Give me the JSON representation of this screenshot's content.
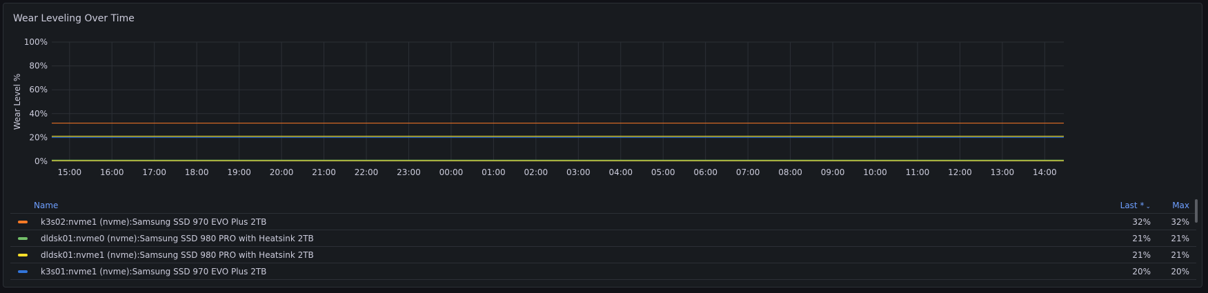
{
  "panel": {
    "title": "Wear Leveling Over Time"
  },
  "legend": {
    "name_header": "Name",
    "last_header": "Last *",
    "max_header": "Max",
    "rows": [
      {
        "name": "k3s02:nvme1 (nvme):Samsung SSD 970 EVO Plus 2TB",
        "color": "#ff7a26",
        "last": "32%",
        "max": "32%"
      },
      {
        "name": "dldsk01:nvme0 (nvme):Samsung SSD 980 PRO with Heatsink 2TB",
        "color": "#73bf69",
        "last": "21%",
        "max": "21%"
      },
      {
        "name": "dldsk01:nvme1 (nvme):Samsung SSD 980 PRO with Heatsink 2TB",
        "color": "#fade2a",
        "last": "21%",
        "max": "21%"
      },
      {
        "name": "k3s01:nvme1 (nvme):Samsung SSD 970 EVO Plus 2TB",
        "color": "#3274d9",
        "last": "20%",
        "max": "20%"
      }
    ]
  },
  "chart_data": {
    "type": "line",
    "title": "Wear Leveling Over Time",
    "xlabel": "",
    "ylabel": "Wear Level %",
    "ylim": [
      0,
      100
    ],
    "y_ticks": [
      "0%",
      "20%",
      "40%",
      "60%",
      "80%",
      "100%"
    ],
    "x_range_hours": [
      14.58,
      14.45
    ],
    "x_ticks": [
      "15:00",
      "16:00",
      "17:00",
      "18:00",
      "19:00",
      "20:00",
      "21:00",
      "22:00",
      "23:00",
      "00:00",
      "01:00",
      "02:00",
      "03:00",
      "04:00",
      "05:00",
      "06:00",
      "07:00",
      "08:00",
      "09:00",
      "10:00",
      "11:00",
      "12:00",
      "13:00",
      "14:00"
    ],
    "grid": true,
    "legend_position": "bottom",
    "series": [
      {
        "name": "k3s02:nvme1 (nvme):Samsung SSD 970 EVO Plus 2TB",
        "color": "#ff7a26",
        "values": [
          32,
          32
        ]
      },
      {
        "name": "dldsk01:nvme0 (nvme):Samsung SSD 980 PRO with Heatsink 2TB",
        "color": "#73bf69",
        "values": [
          21,
          21
        ]
      },
      {
        "name": "dldsk01:nvme1 (nvme):Samsung SSD 980 PRO with Heatsink 2TB",
        "color": "#fade2a",
        "values": [
          21,
          21
        ]
      },
      {
        "name": "k3s01:nvme1 (nvme):Samsung SSD 970 EVO Plus 2TB",
        "color": "#3274d9",
        "values": [
          20,
          20
        ]
      },
      {
        "name": "",
        "color": "#73bf69",
        "values": [
          1,
          1
        ]
      },
      {
        "name": "",
        "color": "#fade2a",
        "values": [
          0.5,
          0.5
        ]
      }
    ]
  }
}
